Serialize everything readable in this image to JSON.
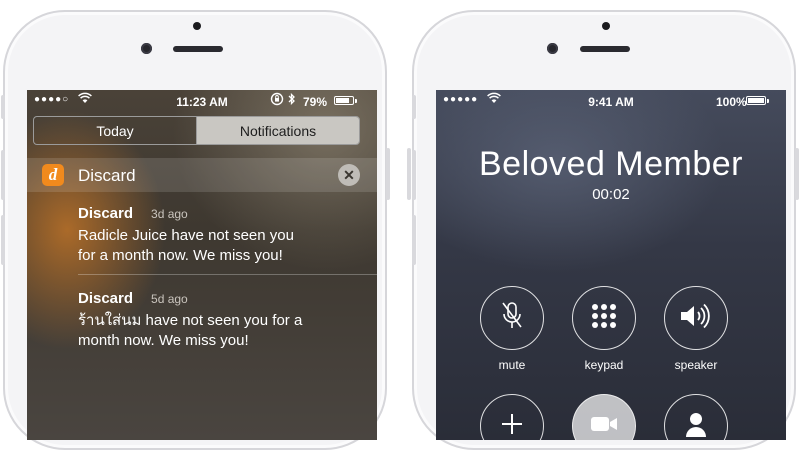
{
  "left_phone": {
    "status_bar": {
      "signal": "●●●●○",
      "time": "11:23 AM",
      "battery_percent": "79%",
      "battery_level": 0.79
    },
    "segments": {
      "today_label": "Today",
      "notifications_label": "Notifications",
      "selected": "Notifications"
    },
    "app_group": {
      "app_icon_letter": "d",
      "app_icon_color": "#f18a1d",
      "app_name": "Discard",
      "clear_label": "✕"
    },
    "notifications": [
      {
        "title": "Discard",
        "time_ago": "3d ago",
        "body_line1": "Radicle Juice have not seen you",
        "body_line2": "for a month now. We miss you!"
      },
      {
        "title": "Discard",
        "time_ago": "5d ago",
        "body_line1": "ร้านใส่นม have not seen you for a",
        "body_line2": "month now. We miss you!"
      }
    ]
  },
  "right_phone": {
    "status_bar": {
      "signal": "●●●●●",
      "time": "9:41 AM",
      "battery_percent": "100%",
      "battery_level": 1.0
    },
    "caller_name": "Beloved Member",
    "call_duration": "00:02",
    "buttons": [
      {
        "label": "mute",
        "icon": "microphone-muted-icon"
      },
      {
        "label": "keypad",
        "icon": "keypad-icon"
      },
      {
        "label": "speaker",
        "icon": "speaker-icon"
      },
      {
        "label": "",
        "icon": "add-call-icon"
      },
      {
        "label": "",
        "icon": "facetime-icon"
      },
      {
        "label": "",
        "icon": "contacts-icon"
      }
    ]
  }
}
